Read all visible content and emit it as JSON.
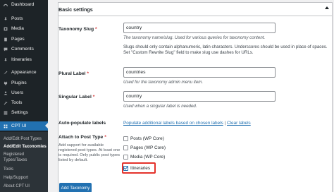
{
  "sidebar": {
    "items": [
      {
        "label": "Dashboard",
        "icon": "dashboard-icon"
      },
      {
        "label": "Posts",
        "icon": "pin-icon"
      },
      {
        "label": "Media",
        "icon": "media-icon"
      },
      {
        "label": "Pages",
        "icon": "pages-icon"
      },
      {
        "label": "Comments",
        "icon": "comments-icon"
      },
      {
        "label": "Itineraries",
        "icon": "pin-icon"
      },
      {
        "label": "Appearance",
        "icon": "brush-icon"
      },
      {
        "label": "Plugins",
        "icon": "plugin-icon"
      },
      {
        "label": "Users",
        "icon": "users-icon"
      },
      {
        "label": "Tools",
        "icon": "wrench-icon"
      },
      {
        "label": "Settings",
        "icon": "settings-icon"
      },
      {
        "label": "CPT UI",
        "icon": "grid-icon"
      }
    ],
    "submenu": [
      {
        "label": "Add/Edit Post Types"
      },
      {
        "label": "Add/Edit Taxonomies"
      },
      {
        "label": "Registered"
      },
      {
        "label": "Types/Taxes"
      },
      {
        "label": "Tools"
      },
      {
        "label": "Help/Support"
      },
      {
        "label": "About CPT UI"
      }
    ],
    "colors": {
      "bg": "#1d2327",
      "submenu_bg": "#2c3338",
      "active": "#2271b1"
    }
  },
  "panel": {
    "title": "Basic settings",
    "taxonomy_slug": {
      "label": "Taxonomy Slug",
      "required": "*",
      "value": "country",
      "description": "The taxonomy name/slug. Used for various queries for taxonomy content.",
      "note_line1": "Slugs should only contain alphanumeric, latin characters. Underscores should be used in place of spaces.",
      "note_line2": "Set \"Custom Rewrite Slug\" field to make slug use dashes for URLs."
    },
    "plural_label": {
      "label": "Plural Label",
      "required": "*",
      "value": "countries",
      "description": "Used for the taxonomy admin menu item."
    },
    "singular_label": {
      "label": "Singular Label",
      "required": "*",
      "value": "country",
      "description": "Used when a singular label is needed."
    },
    "auto_populate": {
      "label": "Auto-populate labels",
      "link_populate": "Populate additional labels based on chosen labels",
      "separator": " | ",
      "link_clear": "Clear labels"
    },
    "attach_post_type": {
      "label": "Attach to Post Type",
      "required": "*",
      "help_lines": [
        "Add support for available",
        "registered post types. At least one",
        "is required. Only public post types",
        "listed by default."
      ],
      "options": [
        {
          "label": "Posts (WP Core)",
          "checked": false
        },
        {
          "label": "Pages (WP Core)",
          "checked": false
        },
        {
          "label": "Media (WP Core)",
          "checked": false
        },
        {
          "label": "Itineraries",
          "checked": true
        }
      ]
    },
    "add_button": "Add Taxonomy"
  },
  "colors": {
    "accent": "#2271b1",
    "highlight": "#e4322b",
    "required": "#d63638"
  }
}
